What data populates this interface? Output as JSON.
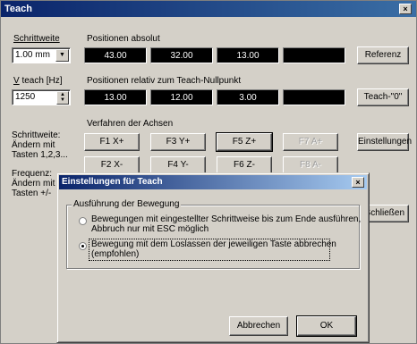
{
  "window": {
    "title": "Teach",
    "close_glyph": "×"
  },
  "controls": {
    "step_label": "Schrittweite",
    "step_value": "1.00 mm",
    "vteach_label": "V teach [Hz]",
    "vteach_value": "1250",
    "step_help": "Schrittweite:\nÄndern mit\nTasten 1,2,3...",
    "freq_help": "Frequenz:\nÄndern mit\nTasten +/-"
  },
  "positions": {
    "absolute_label": "Positionen absolut",
    "absolute_values": [
      "43.00",
      "32.00",
      "13.00",
      ""
    ],
    "relative_label": "Positionen relativ zum Teach-Nullpunkt",
    "relative_values": [
      "13.00",
      "12.00",
      "3.00",
      ""
    ],
    "reference_button": "Referenz",
    "teach_zero_button": "Teach-\"0\""
  },
  "axes": {
    "label": "Verfahren der Achsen",
    "row1": [
      "F1 X+",
      "F3 Y+",
      "F5 Z+",
      "F7 A+"
    ],
    "row2": [
      "F2 X-",
      "F4 Y-",
      "F6 Z-",
      "F8 A-"
    ],
    "settings_button": "Einstellungen",
    "close_button": "Schließen"
  },
  "dialog": {
    "title": "Einstellungen für Teach",
    "close_glyph": "×",
    "group_label": "Ausführung der Bewegung",
    "option1": "Bewegungen mit eingestellter Schrittweise bis zum Ende ausführen,\nAbbruch nur mit ESC möglich",
    "option2": "Bewegung mit dem Loslassen der jeweiligen Taste abbrechen\n(empfohlen)",
    "selected_option": 2,
    "cancel_button": "Abbrechen",
    "ok_button": "OK"
  }
}
